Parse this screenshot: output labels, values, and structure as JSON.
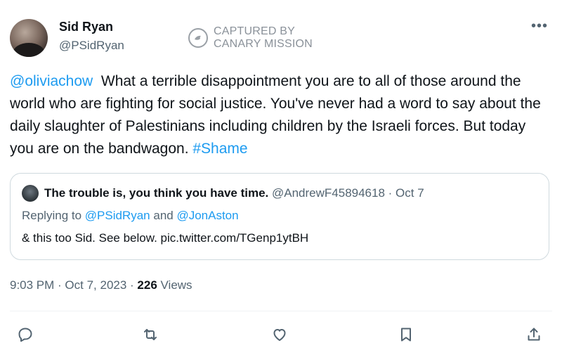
{
  "author": {
    "name": "Sid Ryan",
    "handle": "@PSidRyan"
  },
  "watermark": {
    "line1": "CAPTURED BY",
    "line2": "CANARY MISSION"
  },
  "tweet": {
    "mention": "@oliviachow",
    "body": "  What a terrible disappointment you are to all of those around the world who are fighting for social justice. You've never had a word to say about the daily slaughter of Palestinians including children by the Israeli forces. But today you are on the bandwagon. ",
    "hashtag": "#Shame"
  },
  "quote": {
    "name": "The trouble is, you think you have time.",
    "meta": " @AndrewF45894618 · Oct 7",
    "reply_prefix": "Replying to ",
    "reply_user1": "@PSidRyan",
    "reply_and": " and ",
    "reply_user2": "@JonAston",
    "body": "& this too Sid. See below. pic.twitter.com/TGenp1ytBH"
  },
  "meta": {
    "timestamp": "9:03 PM · Oct 7, 2023 · ",
    "views_count": "226",
    "views_label": " Views"
  },
  "actions": {
    "icons": [
      "reply-icon",
      "retweet-icon",
      "like-icon",
      "bookmark-icon",
      "share-icon"
    ]
  },
  "colors": {
    "link": "#1d9bf0",
    "secondary_text": "#536471",
    "border": "#cfd9de"
  }
}
